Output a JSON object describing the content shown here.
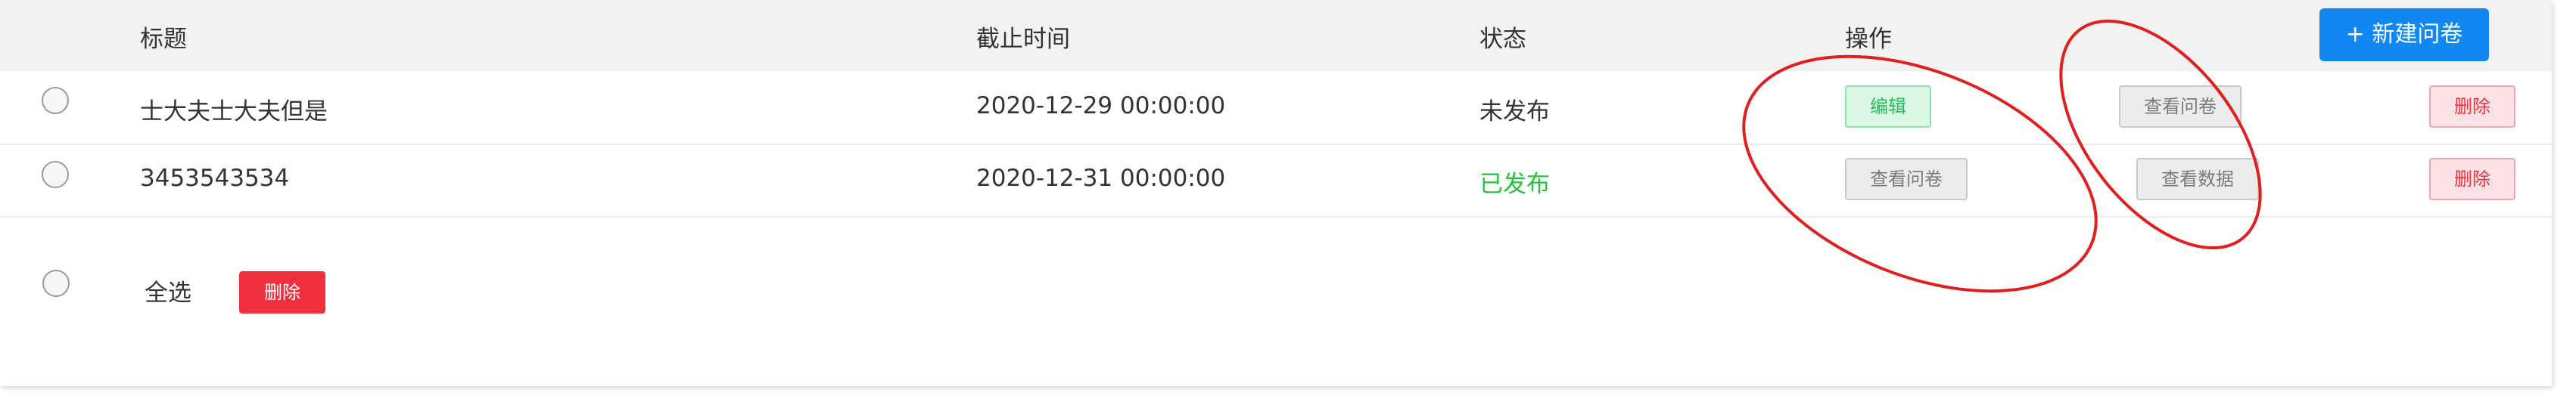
{
  "header": {
    "title_col": "标题",
    "deadline_col": "截止时间",
    "status_col": "状态",
    "action_col": "操作",
    "new_button": "+ 新建问卷"
  },
  "rows": [
    {
      "title": "士大夫士大夫但是",
      "deadline": "2020-12-29 00:00:00",
      "status": "未发布",
      "actions": [
        "编辑",
        "查看问卷",
        "删除"
      ]
    },
    {
      "title": "3453543534",
      "deadline": "2020-12-31 00:00:00",
      "status": "已发布",
      "actions": [
        "查看问卷",
        "查看数据",
        "删除"
      ]
    }
  ],
  "footer": {
    "select_all": "全选",
    "delete_button": "删除"
  },
  "colors": {
    "primary": "#1087f2",
    "danger": "#f0303f",
    "success": "#27c33c",
    "annotation": "#e02020"
  }
}
